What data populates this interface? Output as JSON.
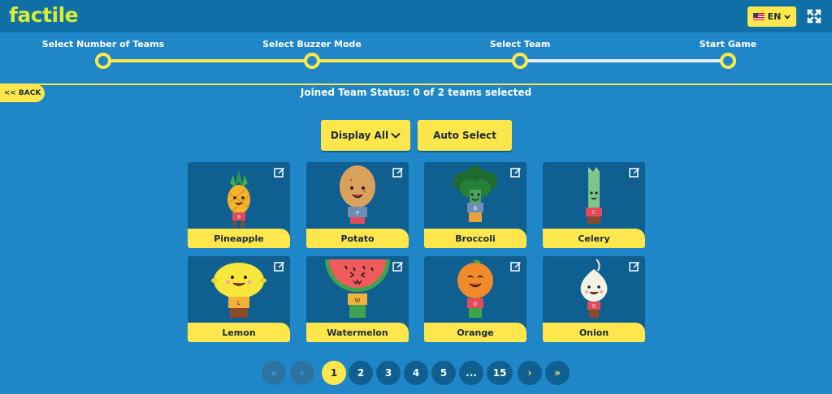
{
  "app": {
    "logo": "factile",
    "language": "EN"
  },
  "steps": [
    {
      "label": "Select Number of Teams"
    },
    {
      "label": "Select Buzzer Mode"
    },
    {
      "label": "Select Team"
    },
    {
      "label": "Start Game"
    }
  ],
  "nav": {
    "back_label": "<< BACK"
  },
  "status": "Joined Team Status: 0 of 2 teams selected",
  "toolbar": {
    "display_all": "Display All",
    "auto_select": "Auto Select"
  },
  "teams": [
    {
      "name": "Pineapple",
      "badge": "P",
      "icon": "pineapple-icon"
    },
    {
      "name": "Potato",
      "badge": "P",
      "icon": "potato-icon"
    },
    {
      "name": "Broccoli",
      "badge": "B",
      "icon": "broccoli-icon"
    },
    {
      "name": "Celery",
      "badge": "C",
      "icon": "celery-icon"
    },
    {
      "name": "Lemon",
      "badge": "L",
      "icon": "lemon-icon"
    },
    {
      "name": "Watermelon",
      "badge": "W",
      "icon": "watermelon-icon"
    },
    {
      "name": "Orange",
      "badge": "O",
      "icon": "orange-icon"
    },
    {
      "name": "Onion",
      "badge": "O",
      "icon": "onion-icon"
    }
  ],
  "pagination": {
    "first": "«",
    "prev": "‹",
    "next": "›",
    "last": "»",
    "pages": [
      "1",
      "2",
      "3",
      "4",
      "5",
      "...",
      "15"
    ],
    "current": "1"
  },
  "colors": {
    "background": "#1f87c7",
    "header": "#0f6fa6",
    "accent": "#fde74c",
    "card": "#0f5f91",
    "logo": "#d6ec3a"
  }
}
